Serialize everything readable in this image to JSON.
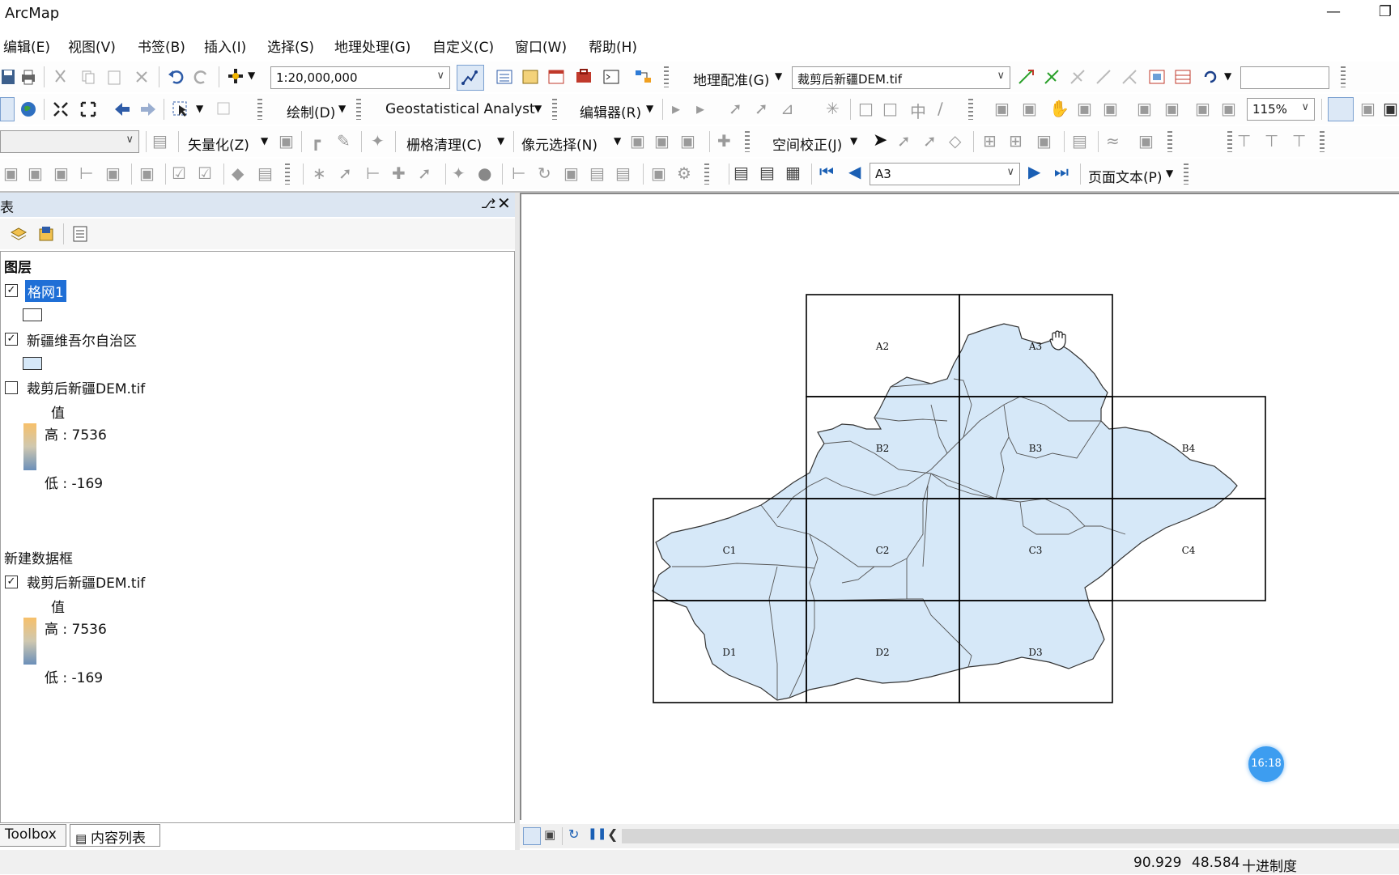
{
  "app": {
    "title": "ArcMap"
  },
  "menubar": {
    "items": [
      "编辑(E)",
      "视图(V)",
      "书签(B)",
      "插入(I)",
      "选择(S)",
      "地理处理(G)",
      "自定义(C)",
      "窗口(W)",
      "帮助(H)"
    ]
  },
  "toolbar1": {
    "scale_value": "1:20,000,000",
    "georef_label": "地理配准(G)",
    "raster_layer": "裁剪后新疆DEM.tif",
    "search_value": ""
  },
  "toolbar2": {
    "draw_label": "绘制(D)",
    "geostat_label": "Geostatistical Analyst",
    "editor_label": "编辑器(R)",
    "zoom_value": "115%"
  },
  "toolbar3": {
    "vectorize_label": "矢量化(Z)",
    "raster_clean_label": "栅格清理(C)",
    "pixel_select_label": "像元选择(N)",
    "spatial_adjust_label": "空间校正(J)"
  },
  "toolbar4": {
    "page_value": "A3",
    "page_text_label": "页面文本(P)"
  },
  "toc": {
    "header_title": "表",
    "frames": [
      {
        "name": "图层",
        "layers": [
          {
            "name": "格网1",
            "checked": true,
            "selected": true,
            "type": "polygon-empty"
          },
          {
            "name": "新疆维吾尔自治区",
            "checked": true,
            "selected": false,
            "type": "polygon-fill"
          },
          {
            "name": "裁剪后新疆DEM.tif",
            "checked": false,
            "selected": false,
            "type": "raster",
            "value_label": "值",
            "high": "高 : 7536",
            "low": "低 : -169"
          }
        ]
      },
      {
        "name": "新建数据框",
        "layers": [
          {
            "name": "裁剪后新疆DEM.tif",
            "checked": true,
            "selected": false,
            "type": "raster",
            "value_label": "值",
            "high": "高 : 7536",
            "low": "低 : -169"
          }
        ]
      }
    ],
    "tabs": [
      "Toolbox",
      "内容列表"
    ]
  },
  "map": {
    "grid_labels": [
      "A2",
      "A3",
      "B2",
      "B3",
      "B4",
      "C1",
      "C2",
      "C3",
      "C4",
      "D1",
      "D2",
      "D3"
    ],
    "fill_color": "#d6e8f8",
    "timer_badge": "16:18"
  },
  "status": {
    "x": "90.929",
    "y": "48.584",
    "units": "十进制度"
  }
}
